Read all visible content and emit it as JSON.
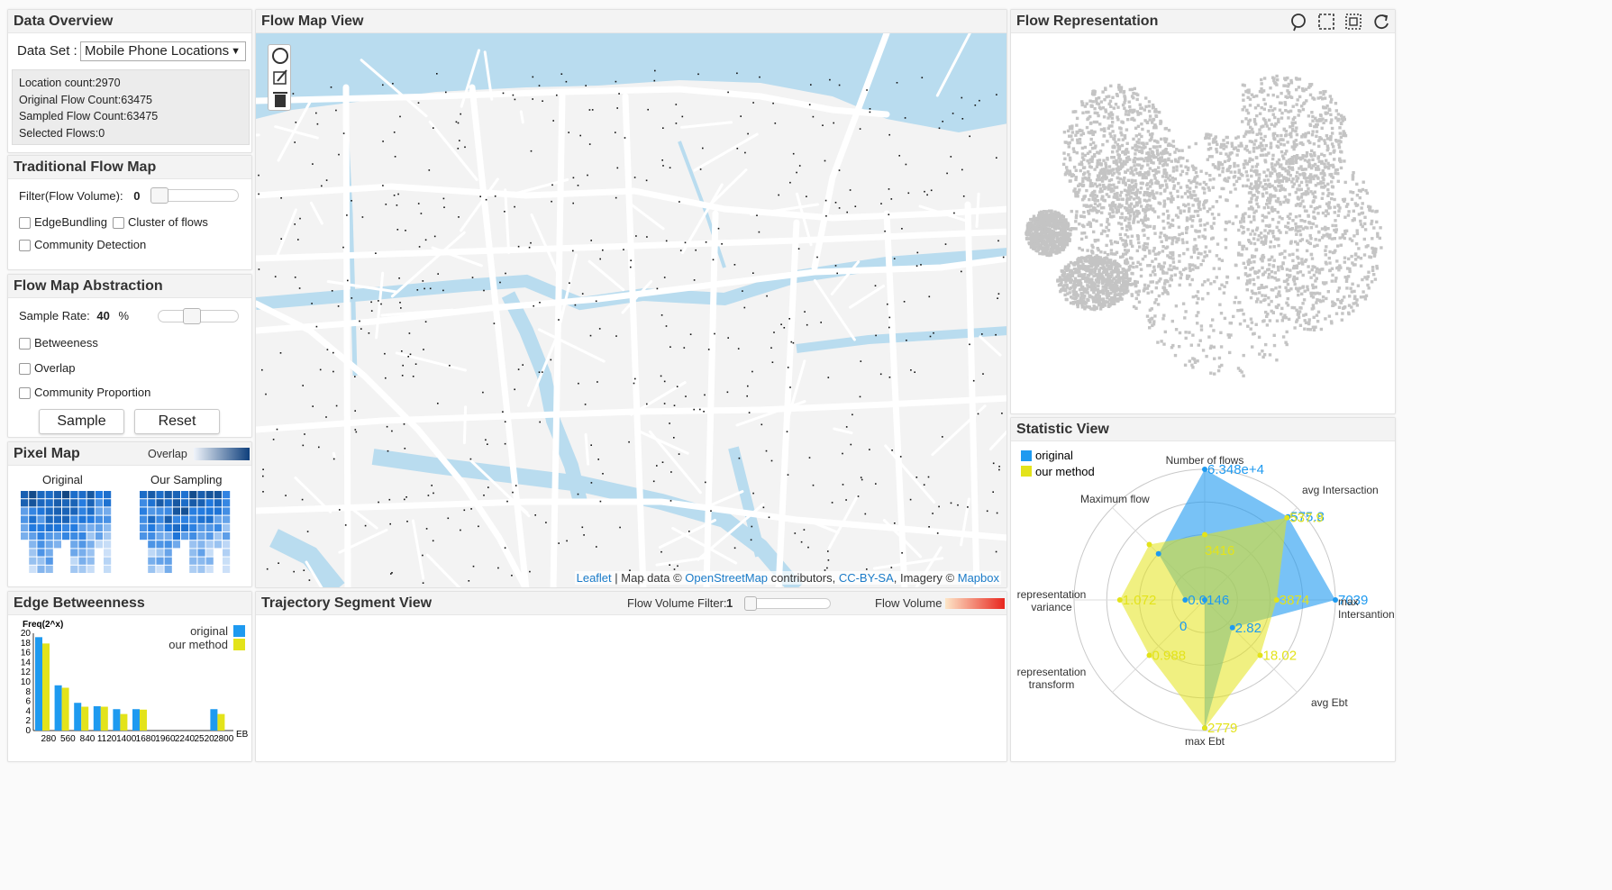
{
  "data_overview": {
    "title": "Data Overview",
    "dataset_label": "Data Set :",
    "dataset_value": "Mobile Phone Locations",
    "stats": [
      "Location count:2970",
      "Original Flow Count:63475",
      "Sampled Flow Count:63475",
      "Selected Flows:0"
    ]
  },
  "traditional": {
    "title": "Traditional Flow Map",
    "filter_label": "Filter(Flow Volume):",
    "filter_value": "0",
    "filter_unit": "%",
    "filter_fraction": 0,
    "options": [
      "EdgeBundling",
      "Cluster of flows",
      "Community Detection"
    ]
  },
  "abstraction": {
    "title": "Flow Map Abstraction",
    "sample_label": "Sample Rate:",
    "sample_value": "40",
    "sample_unit": "%",
    "sample_fraction": 0.4,
    "options": [
      "Betweeness",
      "Overlap",
      "Community Proportion"
    ],
    "sample_button": "Sample",
    "reset_button": "Reset"
  },
  "pixel_map": {
    "title": "Pixel Map",
    "legend_label": "Overlap",
    "original_label": "Original",
    "sampling_label": "Our Sampling"
  },
  "edge_betweenness": {
    "title": "Edge Betweenness",
    "legend": [
      "original",
      "our method"
    ],
    "y_label": "Freq(2^x)",
    "x_label": "EB"
  },
  "flow_map": {
    "title": "Flow Map View",
    "attribution": {
      "leaflet": "Leaflet",
      "sep1": " | Map data © ",
      "osm": "OpenStreetMap",
      "contrib": " contributors, ",
      "license": "CC-BY-SA",
      "imagery": ", Imagery © ",
      "mapbox": "Mapbox"
    },
    "tools": [
      "circle-select-icon",
      "edit-icon",
      "trash-icon"
    ]
  },
  "trajectory": {
    "title": "Trajectory Segment View",
    "filter_label": "Flow Volume Filter:",
    "filter_value": "1",
    "filter_fraction": 0,
    "legend_label": "Flow Volume"
  },
  "flow_repr": {
    "title": "Flow Representation",
    "tools": [
      "lasso-icon",
      "rect-select-icon",
      "rect-zoom-icon",
      "refresh-icon"
    ]
  },
  "statistic": {
    "title": "Statistic View",
    "legend": [
      "original",
      "our method"
    ]
  },
  "colors": {
    "original": "#1e9af0",
    "our_method": "#e3e31a",
    "water": "#b9dcef",
    "land": "#f3f3f3",
    "road": "#ffffff",
    "embedding": "#c4c4c4"
  },
  "chart_data": [
    {
      "type": "bar",
      "title": "Edge Betweenness",
      "xlabel": "EB",
      "ylabel": "Freq(2^x)",
      "categories": [
        "280",
        "560",
        "840",
        "1120",
        "1400",
        "1680",
        "1960",
        "2240",
        "2520",
        "2800"
      ],
      "ylim": [
        0,
        20
      ],
      "yticks": [
        0,
        2,
        4,
        6,
        8,
        10,
        12,
        14,
        16,
        18,
        20
      ],
      "series": [
        {
          "name": "original",
          "values": [
            19.2,
            9.3,
            5.7,
            5.0,
            4.4,
            4.4,
            0,
            0,
            0,
            4.4
          ]
        },
        {
          "name": "our method",
          "values": [
            17.9,
            8.8,
            4.9,
            4.9,
            3.4,
            4.3,
            0,
            0,
            0,
            3.4
          ]
        }
      ]
    },
    {
      "type": "radar",
      "title": "Statistic View",
      "axes": [
        "Number of flows",
        "avg Intersaction",
        "max Intersantion",
        "avg Ebt",
        "max Ebt",
        "representation transform",
        "representation variance",
        "Maximum flow"
      ],
      "series": [
        {
          "name": "original",
          "labels": [
            "6.348e+4",
            "575.8",
            "7039",
            "2.82",
            "",
            "",
            "0.0146",
            ""
          ],
          "values": [
            1.0,
            0.9,
            1.0,
            0.3,
            0.98,
            0.0,
            0.15,
            0.5
          ]
        },
        {
          "name": "our method",
          "labels": [
            "",
            "537.9",
            "3874",
            "18.02",
            "2779",
            "0.988",
            "1.072",
            ""
          ],
          "values": [
            0.5,
            0.89,
            0.55,
            0.6,
            0.98,
            0.6,
            0.65,
            0.6
          ]
        }
      ],
      "center_labels": [
        {
          "text": "3416",
          "series": "our method"
        },
        {
          "text": "0",
          "series": "original"
        }
      ]
    }
  ]
}
